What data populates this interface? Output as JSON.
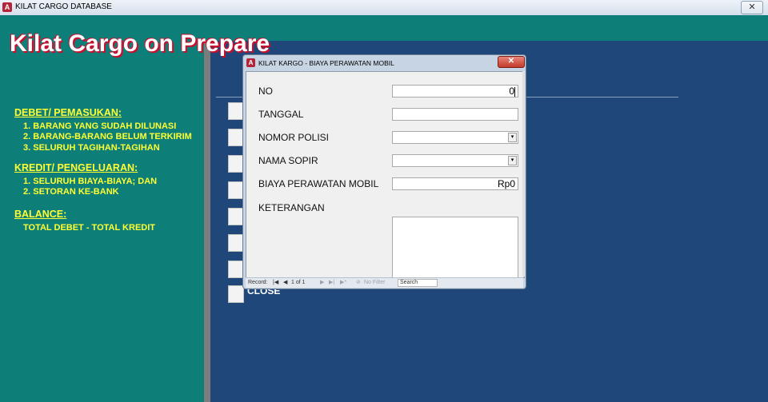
{
  "window": {
    "title": "KILAT CARGO DATABASE",
    "app_icon": "A",
    "close_glyph": "✕"
  },
  "main": {
    "title": "Kilat Cargo on Prepare",
    "debet": {
      "heading": "DEBET/ PEMASUKAN:",
      "items": [
        "1. BARANG YANG SUDAH DILUNASI",
        "2. BARANG-BARANG BELUM TERKIRIM",
        "3. SELURUH TAGIHAN-TAGIHAN"
      ]
    },
    "kredit": {
      "heading": "KREDIT/ PENGELUARAN:",
      "items": [
        "1. SELURUH BIAYA-BIAYA; DAN",
        "2. SETORAN KE-BANK"
      ]
    },
    "balance": {
      "heading": "BALANCE:",
      "formula": "TOTAL DEBET - TOTAL KREDIT"
    },
    "close_label": "CLOSE"
  },
  "dialog": {
    "title": "KILAT KARGO - BIAYA PERAWATAN MOBIL",
    "icon": "A",
    "close_glyph": "✕",
    "fields": {
      "no": {
        "label": "NO",
        "value": "0"
      },
      "tanggal": {
        "label": "TANGGAL",
        "value": ""
      },
      "nomor_polisi": {
        "label": "NOMOR POLISI",
        "value": ""
      },
      "nama_sopir": {
        "label": "NAMA SOPIR",
        "value": ""
      },
      "biaya": {
        "label": "BIAYA PERAWATAN MOBIL",
        "value": "Rp0"
      },
      "keterangan": {
        "label": "KETERANGAN",
        "value": ""
      }
    },
    "dropdown_glyph": "▾",
    "nav": {
      "record_label": "Record:",
      "first_glyph": "|◀",
      "prev_glyph": "◀",
      "position": "1 of 1",
      "next_glyph": "▶",
      "last_glyph": "▶|",
      "new_glyph": "▶*",
      "filter": "No Filter",
      "search": "Search"
    }
  },
  "colors": {
    "teal": "#0d7f78",
    "navy": "#1f4779",
    "yellow": "#ffff33",
    "title_red": "#c8102e"
  }
}
